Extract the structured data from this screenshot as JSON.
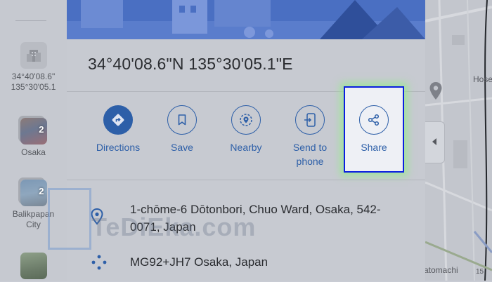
{
  "rail": {
    "items": [
      {
        "label_line1": "34°40'08.6\"",
        "label_line2": "135°30'05.1"
      },
      {
        "label": "Osaka",
        "badge": "2"
      },
      {
        "label_line1": "Balikpapan",
        "label_line2": "City",
        "badge": "2"
      },
      {
        "label": ""
      }
    ]
  },
  "place": {
    "title": "34°40'08.6\"N 135°30'05.1\"E"
  },
  "actions": [
    {
      "label": "Directions",
      "icon": "directions-icon"
    },
    {
      "label": "Save",
      "icon": "bookmark-icon"
    },
    {
      "label": "Nearby",
      "icon": "nearby-icon"
    },
    {
      "label_line1": "Send to",
      "label_line2": "phone",
      "icon": "send-to-phone-icon"
    },
    {
      "label": "Share",
      "icon": "share-icon"
    }
  ],
  "details": {
    "address_line1": "1-chōme-6 Dōtonbori, Chuo Ward, Osaka, 542-",
    "address_line2": "0071, Japan",
    "plus_code": "MG92+JH7 Osaka, Japan"
  },
  "watermark": {
    "text": "TeDiEka.com"
  },
  "map": {
    "label_top": "Hose",
    "label_bottom": "atomachi",
    "label_number": "15"
  },
  "colors": {
    "accent": "#2d5fa8",
    "highlight_border": "#0a1ee0",
    "highlight_glow": "#96eb8c"
  }
}
